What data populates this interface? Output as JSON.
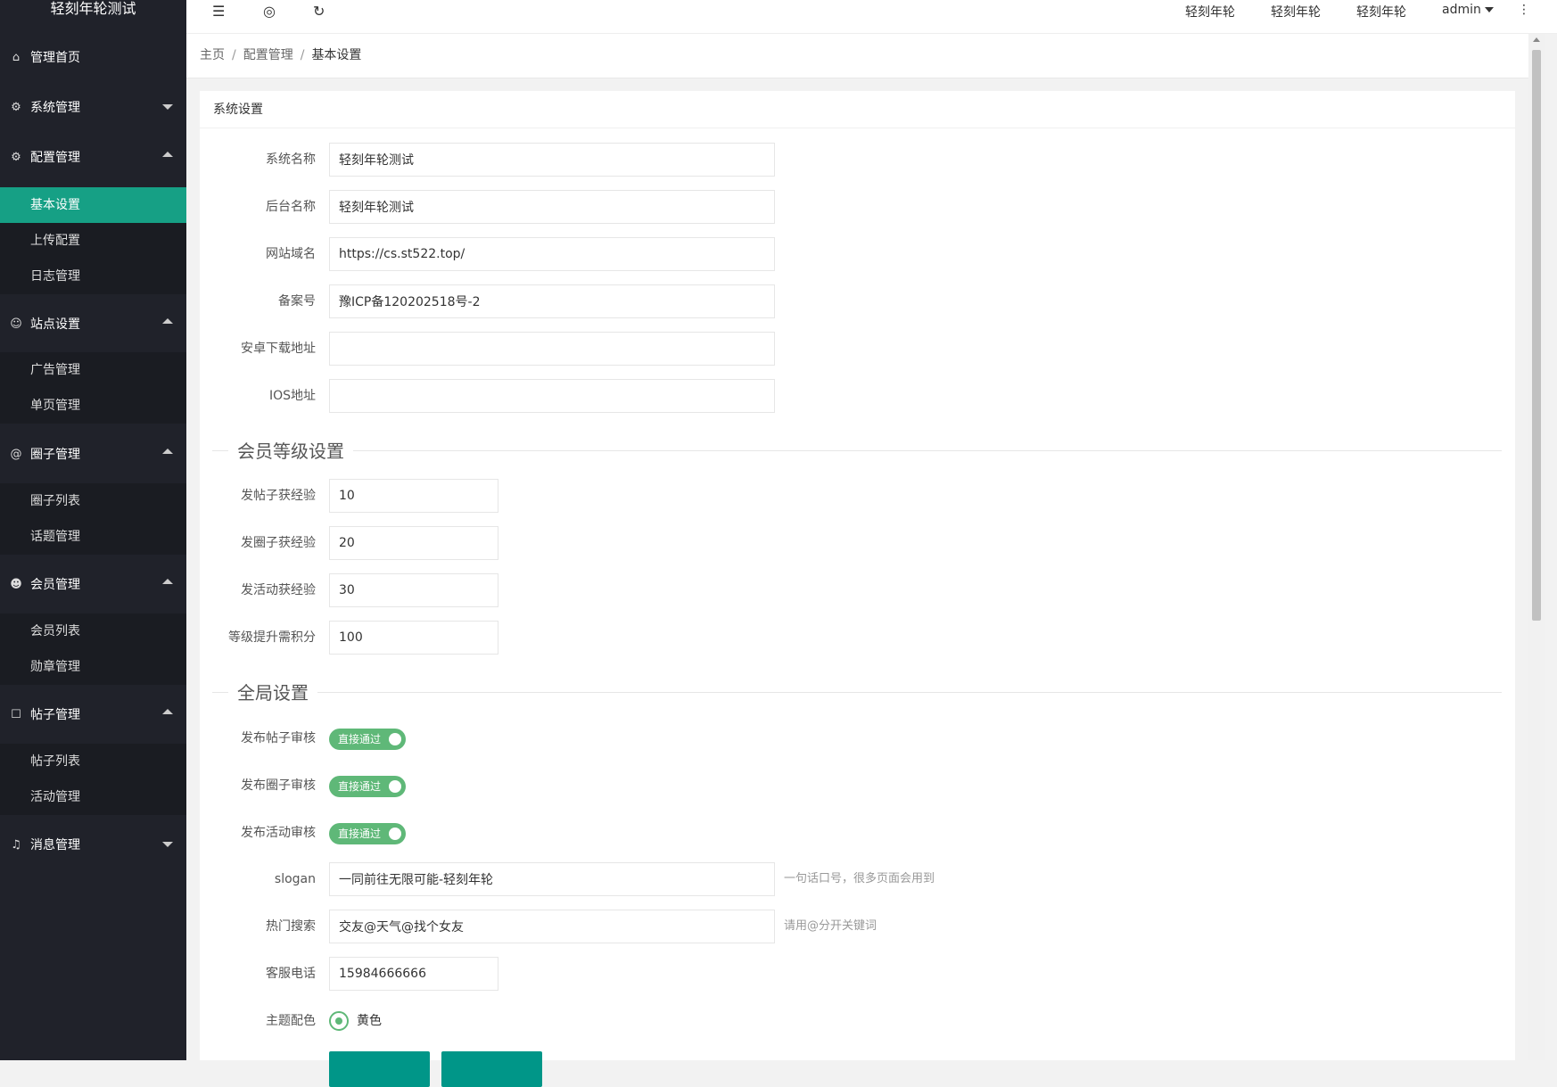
{
  "app": {
    "title": "轻刻年轮测试"
  },
  "sidebar": {
    "groups": [
      {
        "label": "管理首页",
        "icon": "home-icon"
      },
      {
        "label": "系统管理",
        "icon": "gear-icon"
      },
      {
        "label": "配置管理",
        "icon": "gear-icon"
      },
      {
        "label": "站点设置",
        "icon": "smile-icon"
      },
      {
        "label": "圈子管理",
        "icon": "at-icon"
      },
      {
        "label": "会员管理",
        "icon": "user-icon"
      },
      {
        "label": "帖子管理",
        "icon": "cart-icon"
      },
      {
        "label": "消息管理",
        "icon": "speaker-icon"
      }
    ],
    "sub_config": [
      "基本设置",
      "上传配置",
      "日志管理"
    ],
    "sub_site": [
      "广告管理",
      "单页管理"
    ],
    "sub_circle": [
      "圈子列表",
      "话题管理"
    ],
    "sub_member": [
      "会员列表",
      "勋章管理"
    ],
    "sub_post": [
      "帖子列表",
      "活动管理"
    ]
  },
  "topbar": {
    "links": [
      "轻刻年轮",
      "轻刻年轮",
      "轻刻年轮"
    ],
    "user": "admin",
    "more": "⋮"
  },
  "breadcrumb": {
    "home": "主页",
    "parent": "配置管理",
    "current": "基本设置",
    "sep": "/"
  },
  "card": {
    "title": "系统设置"
  },
  "form": {
    "site_name": {
      "label": "系统名称",
      "value": "轻刻年轮测试"
    },
    "admin_name": {
      "label": "后台名称",
      "value": "轻刻年轮测试"
    },
    "domain": {
      "label": "网站域名",
      "value": "https://cs.st522.top/"
    },
    "icp": {
      "label": "备案号",
      "value": "豫ICP备120202518号-2"
    },
    "android_url": {
      "label": "安卓下载地址",
      "value": ""
    },
    "ios_url": {
      "label": "IOS地址",
      "value": ""
    },
    "section_level": "会员等级设置",
    "post_exp": {
      "label": "发帖子获经验",
      "value": "10"
    },
    "circle_exp": {
      "label": "发圈子获经验",
      "value": "20"
    },
    "activity_exp": {
      "label": "发活动获经验",
      "value": "30"
    },
    "level_points": {
      "label": "等级提升需积分",
      "value": "100"
    },
    "section_global": "全局设置",
    "post_audit": {
      "label": "发布帖子审核",
      "value": "直接通过"
    },
    "circle_audit": {
      "label": "发布圈子审核",
      "value": "直接通过"
    },
    "activity_audit": {
      "label": "发布活动审核",
      "value": "直接通过"
    },
    "slogan": {
      "label": "slogan",
      "value": "一同前往无限可能-轻刻年轮",
      "hint": "一句话口号，很多页面会用到"
    },
    "hot_search": {
      "label": "热门搜索",
      "value": "交友@天气@找个女友",
      "hint": "请用@分开关键词"
    },
    "phone": {
      "label": "客服电话",
      "value": "15984666666"
    },
    "theme": {
      "label": "主题配色",
      "value": "黄色"
    }
  },
  "colors": {
    "accent": "#009688",
    "active": "#16a085",
    "switch": "#5fb878",
    "sidebar": "#20222a"
  }
}
